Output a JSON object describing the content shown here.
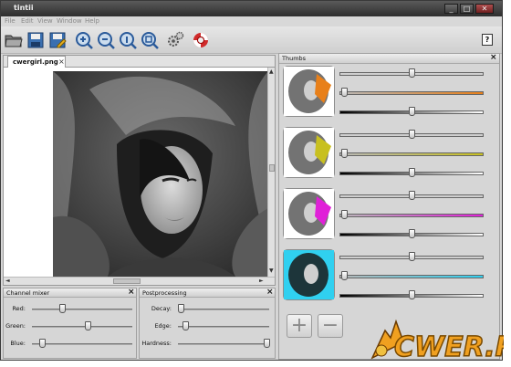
{
  "window": {
    "title": "tintii",
    "controls": [
      "_",
      "□",
      "✕"
    ]
  },
  "menu": [
    "File",
    "Edit",
    "View",
    "Window",
    "Help"
  ],
  "toolbar": {
    "icons": [
      "open-folder-icon",
      "save-icon",
      "save-as-icon",
      "zoom-in-icon",
      "zoom-out-icon",
      "zoom-fit-icon",
      "zoom-actual-icon",
      "settings-gears-icon",
      "help-lifebuoy-icon"
    ],
    "help_label": "?"
  },
  "document": {
    "tab_label": "cwergirl.png",
    "tab_close": "×"
  },
  "scroll": {
    "up": "▲",
    "down": "▼",
    "left": "◄",
    "right": "►"
  },
  "channel_mixer": {
    "title": "Channel mixer",
    "close": "×",
    "rows": [
      {
        "label": "Red:",
        "value": 0.3
      },
      {
        "label": "Green:",
        "value": 0.55
      },
      {
        "label": "Blue:",
        "value": 0.1
      }
    ]
  },
  "postprocessing": {
    "title": "Postprocessing",
    "close": "×",
    "rows": [
      {
        "label": "Decay:",
        "value": 0.03
      },
      {
        "label": "Edge:",
        "value": 0.08
      },
      {
        "label": "Hardness:",
        "value": 0.97
      }
    ]
  },
  "thumbs": {
    "title": "Thumbs",
    "close": "×",
    "items": [
      {
        "color": "#e8801a",
        "hue": 0.5,
        "saturation": 0.03,
        "value": 0.5
      },
      {
        "color": "#c8c020",
        "hue": 0.5,
        "saturation": 0.03,
        "value": 0.5
      },
      {
        "color": "#e020d8",
        "hue": 0.5,
        "saturation": 0.03,
        "value": 0.5
      },
      {
        "color": "#30d0f0",
        "hue": 0.5,
        "saturation": 0.03,
        "value": 0.5
      }
    ],
    "add_label": "+",
    "remove_label": "−"
  },
  "watermark": {
    "text": "CWER.RU"
  }
}
